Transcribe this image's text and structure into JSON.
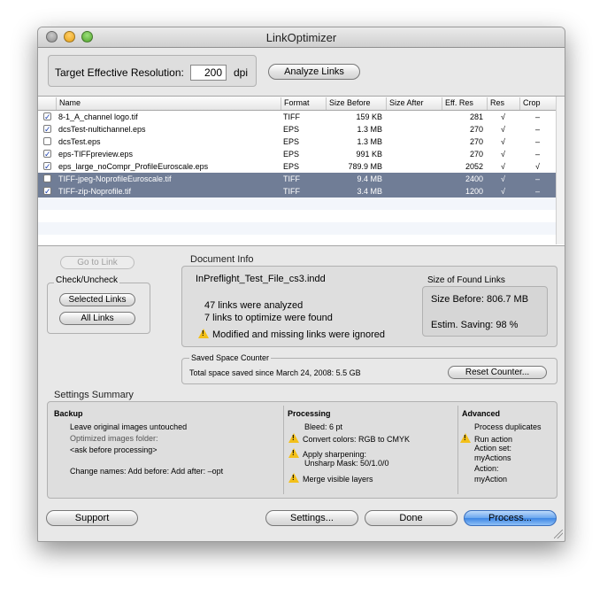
{
  "window": {
    "title": "LinkOptimizer"
  },
  "resolution": {
    "label": "Target Effective Resolution:",
    "value": "200",
    "unit": "dpi",
    "analyze_button": "Analyze Links"
  },
  "table": {
    "columns": [
      "Name",
      "Format",
      "Size Before",
      "Size After",
      "Eff. Res",
      "Res",
      "Crop"
    ],
    "rows": [
      {
        "checked": true,
        "name": "8-1_A_channel logo.tif",
        "format": "TIFF",
        "size_before": "159 KB",
        "size_after": "",
        "eff_res": "281",
        "res": "√",
        "crop": "–",
        "selected": false
      },
      {
        "checked": true,
        "name": "dcsTest-nultichannel.eps",
        "format": "EPS",
        "size_before": "1.3 MB",
        "size_after": "",
        "eff_res": "270",
        "res": "√",
        "crop": "–",
        "selected": false
      },
      {
        "checked": false,
        "name": "dcsTest.eps",
        "format": "EPS",
        "size_before": "1.3 MB",
        "size_after": "",
        "eff_res": "270",
        "res": "√",
        "crop": "–",
        "selected": false
      },
      {
        "checked": true,
        "name": "eps-TIFFpreview.eps",
        "format": "EPS",
        "size_before": "991 KB",
        "size_after": "",
        "eff_res": "270",
        "res": "√",
        "crop": "–",
        "selected": false
      },
      {
        "checked": true,
        "name": "eps_large_noCompr_ProfileEuroscale.eps",
        "format": "EPS",
        "size_before": "789.9 MB",
        "size_after": "",
        "eff_res": "2052",
        "res": "√",
        "crop": "√",
        "selected": false
      },
      {
        "checked": false,
        "name": "TIFF-jpeg-NoprofileEuroscale.tif",
        "format": "TIFF",
        "size_before": "9.4 MB",
        "size_after": "",
        "eff_res": "2400",
        "res": "√",
        "crop": "–",
        "selected": true
      },
      {
        "checked": true,
        "name": "TIFF-zip-Noprofile.tif",
        "format": "TIFF",
        "size_before": "3.4 MB",
        "size_after": "",
        "eff_res": "1200",
        "res": "√",
        "crop": "–",
        "selected": true
      }
    ],
    "checkmark": "✓"
  },
  "left_panel": {
    "go_to_link": "Go to Link",
    "check_group_title": "Check/Uncheck",
    "selected_links": "Selected Links",
    "all_links": "All Links"
  },
  "document_info": {
    "title": "Document Info",
    "filename": "InPreflight_Test_File_cs3.indd",
    "analyzed": "47 links were analyzed",
    "to_optimize": "7 links to optimize were found",
    "warning": "Modified and missing links were ignored",
    "found_title": "Size of Found Links",
    "size_before": "Size Before: 806.7 MB",
    "saving": "Estim. Saving: 98 %"
  },
  "counter": {
    "title": "Saved Space Counter",
    "text": "Total space saved since March 24, 2008: 5.5 GB",
    "reset_button": "Reset Counter..."
  },
  "settings": {
    "title": "Settings Summary",
    "backup": {
      "heading": "Backup",
      "line1": "Leave original images untouched",
      "line2": "Optimized images folder:",
      "line3": "<ask before processing>",
      "line4": "Change names: Add before:   Add after: –opt"
    },
    "processing": {
      "heading": "Processing",
      "bleed": "Bleed: 6 pt",
      "convert": "Convert colors: RGB to CMYK",
      "sharpen1": "Apply sharpening:",
      "sharpen2": "Unsharp Mask: 50/1.0/0",
      "merge": "Merge visible layers"
    },
    "advanced": {
      "heading": "Advanced",
      "dup": "Process duplicates",
      "run": "Run action",
      "set1": "Action set:",
      "set2": "myActions",
      "act1": "Action:",
      "act2": "myAction"
    }
  },
  "footer": {
    "support": "Support",
    "settings": "Settings...",
    "done": "Done",
    "process": "Process..."
  },
  "colors": {
    "selection": "#707d96",
    "primary_button": "#5a9be9",
    "warning": "#f3c019"
  }
}
